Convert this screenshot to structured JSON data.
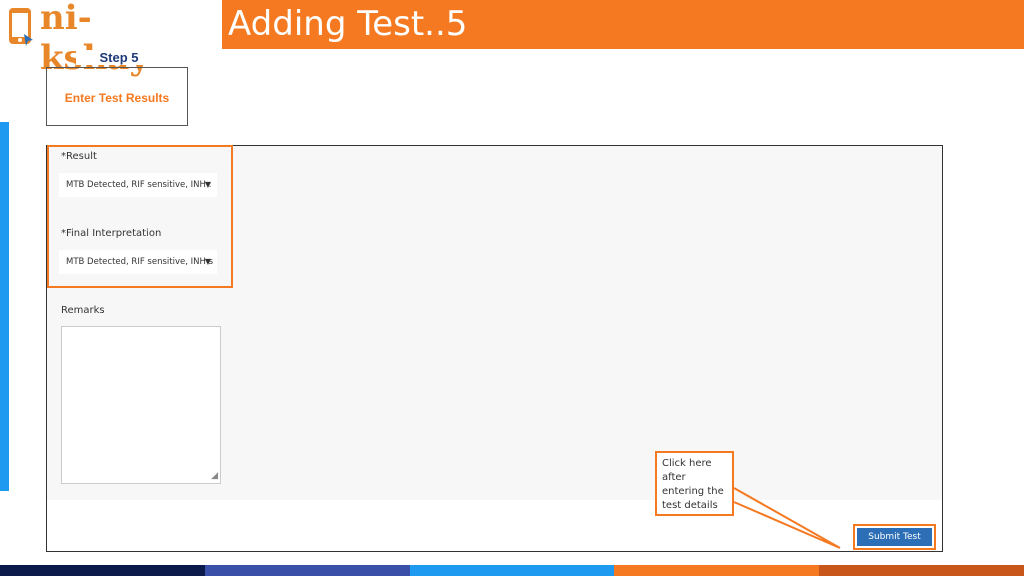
{
  "header": {
    "logo_text": "ni-kshay",
    "title": "Adding Test..5"
  },
  "step": {
    "label": "Step 5",
    "text": "Enter Test Results"
  },
  "form": {
    "result_label": "*Result",
    "result_value": "MTB Detected, RIF sensitive, INH :",
    "final_label": "*Final Interpretation",
    "final_value": "MTB Detected, RIF sensitive, INH s",
    "remarks_label": "Remarks",
    "remarks_value": ""
  },
  "callout": {
    "text": "Click  here after entering the test details"
  },
  "submit": {
    "label": "Submit Test"
  },
  "colors": {
    "accent": "#f47920",
    "button": "#2d6fb7",
    "footer": [
      "#0b1a4a",
      "#3a4fa8",
      "#1e9bf0",
      "#f47920",
      "#c8551a"
    ]
  }
}
